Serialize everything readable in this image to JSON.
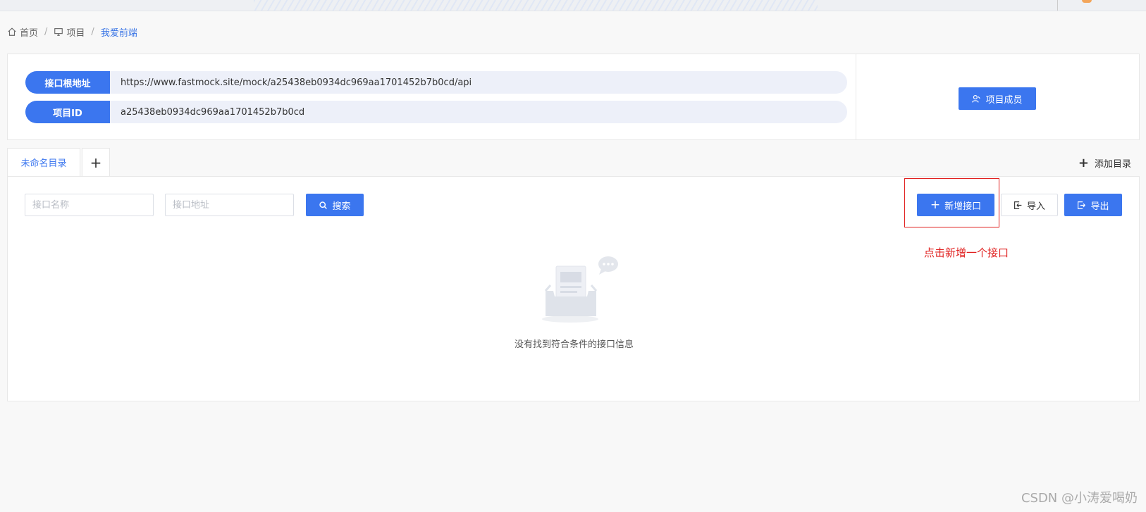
{
  "breadcrumb": {
    "home": "首页",
    "projects": "项目",
    "current": "我爱前端"
  },
  "project_info": {
    "root_label": "接口根地址",
    "root_value": "https://www.fastmock.site/mock/a25438eb0934dc969aa1701452b7b0cd/api",
    "id_label": "项目ID",
    "id_value": "a25438eb0934dc969aa1701452b7b0cd"
  },
  "members_button": "项目成员",
  "tabs": {
    "active": "未命名目录",
    "add_tab": "+",
    "add_directory": "添加目录"
  },
  "filters": {
    "name_placeholder": "接口名称",
    "url_placeholder": "接口地址",
    "search_label": "搜索"
  },
  "actions": {
    "new_label": "新增接口",
    "import_label": "导入",
    "export_label": "导出"
  },
  "annotation": "点击新增一个接口",
  "empty_message": "没有找到符合条件的接口信息",
  "watermark": "CSDN @小涛爱喝奶",
  "colors": {
    "primary": "#3b76ef",
    "annotation_red": "#e0201f",
    "pill_bg": "#edf0f9"
  }
}
